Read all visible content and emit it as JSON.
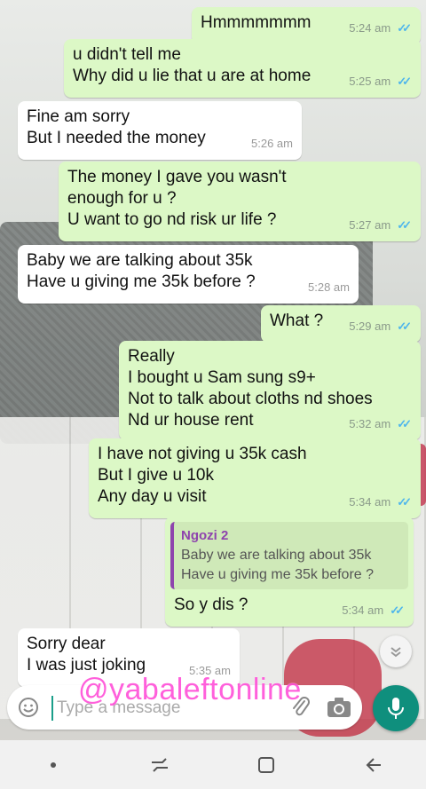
{
  "messages": [
    {
      "dir": "out",
      "text": "Hmmmmmmm",
      "time": "5:24 am"
    },
    {
      "dir": "out",
      "text": "u didn't tell me\nWhy did u lie that u are at home",
      "time": "5:25 am"
    },
    {
      "dir": "in",
      "text": "Fine am sorry\nBut I needed the money",
      "time": "5:26 am"
    },
    {
      "dir": "out",
      "text": "The money I gave you wasn't\nenough for u  ?\nU want to go nd risk ur life  ?",
      "time": "5:27 am"
    },
    {
      "dir": "in",
      "text": "Baby we are talking about 35k\nHave u giving me 35k before  ?",
      "time": "5:28 am"
    },
    {
      "dir": "out",
      "text": "What ?",
      "time": "5:29 am"
    },
    {
      "dir": "out",
      "text": "Really\nI bought u Sam sung s9+\nNot to talk about cloths nd shoes\nNd ur house rent",
      "time": "5:32 am"
    },
    {
      "dir": "out",
      "text": "I have not giving u 35k cash\nBut I give u 10k\nAny day u visit",
      "time": "5:34 am"
    },
    {
      "dir": "out",
      "quote_name": "Ngozi 2",
      "quote_text": "Baby we are talking about 35k\nHave u giving me 35k before  ?",
      "text": "So y dis ?",
      "time": "5:34 am"
    },
    {
      "dir": "in",
      "text": "Sorry dear\nI was just joking",
      "time": "5:35 am"
    }
  ],
  "read_ticks": "✓✓",
  "watermark": "@yabaleftonline",
  "composer": {
    "placeholder": "Type a message"
  },
  "colors": {
    "outgoing": "#dcf8c6",
    "incoming": "#ffffff",
    "accent": "#0f8f7d",
    "ticks": "#4fb6ec"
  },
  "icons": [
    "emoji-icon",
    "attach-icon",
    "camera-icon",
    "mic-icon",
    "chevron-down-icon",
    "nav-dot-icon",
    "recent-apps-icon",
    "home-icon",
    "back-icon"
  ]
}
